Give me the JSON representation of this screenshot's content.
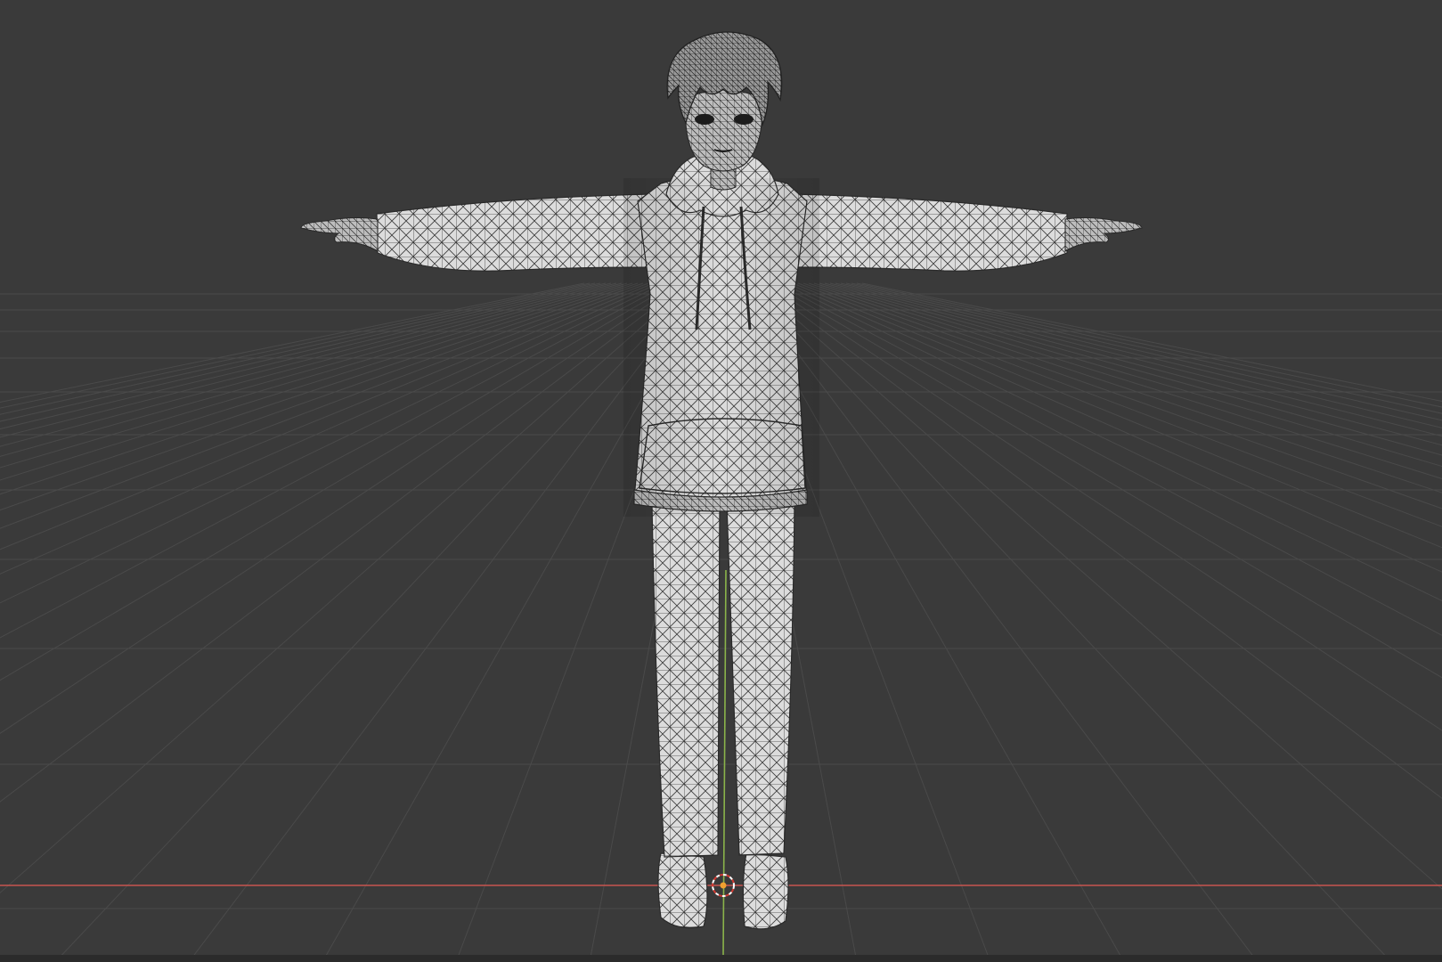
{
  "viewport": {
    "background_color": "#3a3a3a",
    "grid_line_color": "#4a4a4a",
    "x_axis_color": "#c8554f",
    "y_axis_color": "#8ab34a",
    "mesh_fill_color": "#dcdcdc",
    "wire_color": "#2e2e2e",
    "overlay_wireframe": true,
    "show_floor_grid": true,
    "show_3d_cursor": true
  },
  "scene": {
    "objects": [
      {
        "kind": "character-mesh",
        "pose": "T-pose",
        "clothing": [
          "hoodie",
          "pants",
          "sneakers"
        ]
      }
    ]
  },
  "icons": {
    "origin_marker": "3d-cursor-icon"
  }
}
